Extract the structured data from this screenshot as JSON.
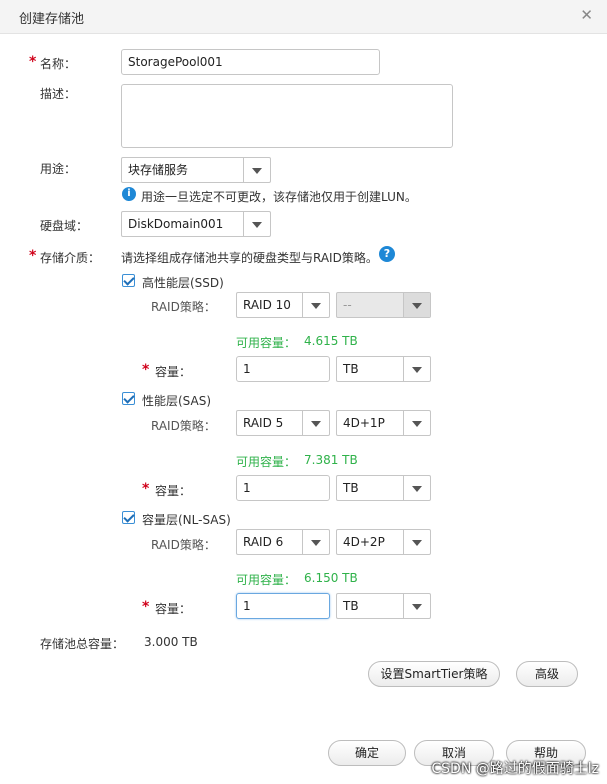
{
  "dialog": {
    "title": "创建存储池",
    "close_icon": "close-icon"
  },
  "form": {
    "name_label": "名称：",
    "name_value": "StoragePool001",
    "desc_label": "描述：",
    "desc_value": "",
    "usage_label": "用途：",
    "usage_value": "块存储服务",
    "usage_info": "用途一旦选定不可更改，该存储池仅用于创建LUN。",
    "domain_label": "硬盘域：",
    "domain_value": "DiskDomain001",
    "media_label": "存储介质：",
    "media_hint": "请选择组成存储池共享的硬盘类型与RAID策略。"
  },
  "tiers": [
    {
      "name": "高性能层(SSD)",
      "checked": true,
      "raid_label": "RAID策略：",
      "raid": "RAID 10",
      "layout": "--",
      "layout_disabled": true,
      "avail_label": "可用容量：",
      "avail": "4.615 TB",
      "cap_label": "容量：",
      "cap": "1",
      "unit": "TB"
    },
    {
      "name": "性能层(SAS)",
      "checked": true,
      "raid_label": "RAID策略：",
      "raid": "RAID 5",
      "layout": "4D+1P",
      "layout_disabled": false,
      "avail_label": "可用容量：",
      "avail": "7.381 TB",
      "cap_label": "容量：",
      "cap": "1",
      "unit": "TB"
    },
    {
      "name": "容量层(NL-SAS)",
      "checked": true,
      "raid_label": "RAID策略：",
      "raid": "RAID 6",
      "layout": "4D+2P",
      "layout_disabled": false,
      "avail_label": "可用容量：",
      "avail": "6.150 TB",
      "cap_label": "容量：",
      "cap": "1",
      "unit": "TB"
    }
  ],
  "total": {
    "label": "存储池总容量：",
    "value": "3.000 TB"
  },
  "buttons": {
    "smarttier": "设置SmartTier策略",
    "advanced": "高级",
    "ok": "确定",
    "cancel": "取消",
    "help": "帮助"
  },
  "watermark": "CSDN @路过的假面骑士lz",
  "colors": {
    "accent": "#1e88d6",
    "required": "#d0021b",
    "available": "#2fb24a"
  }
}
